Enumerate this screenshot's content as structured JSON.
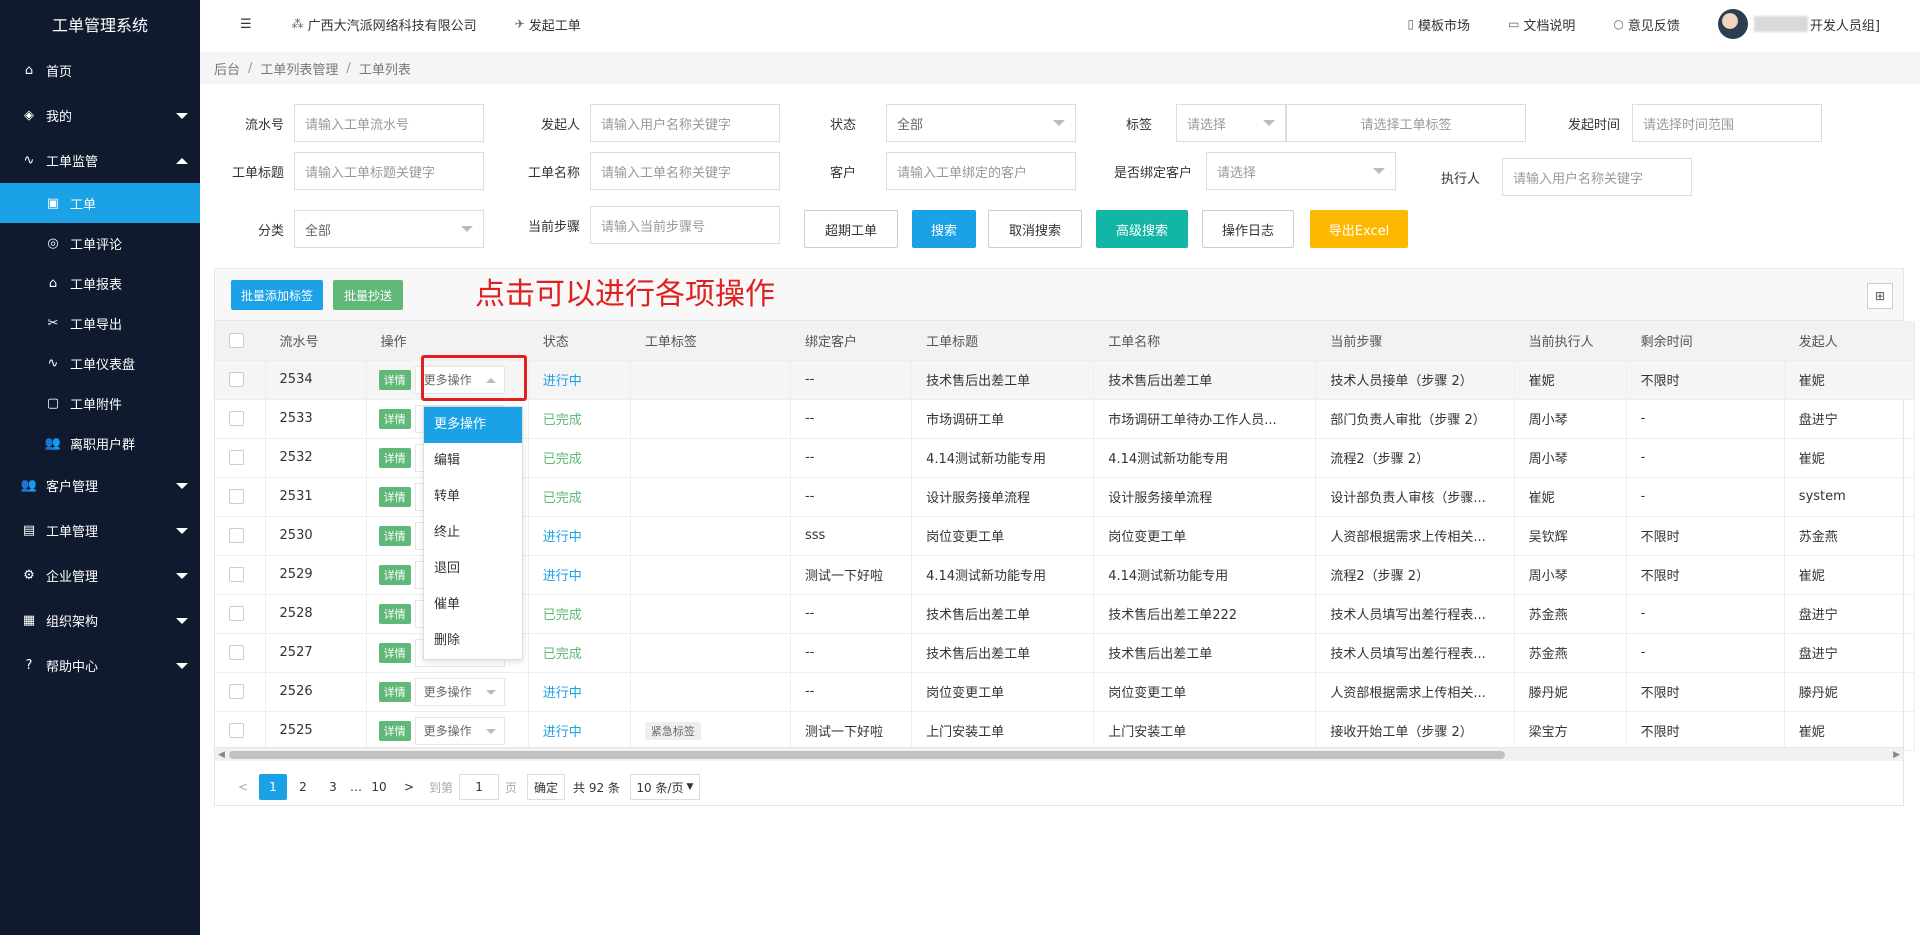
{
  "app": {
    "title": "工单管理系统"
  },
  "sidebar": {
    "items": [
      {
        "icon": "⌂",
        "label": "首页"
      },
      {
        "icon": "◈",
        "label": "我的"
      },
      {
        "icon": "∿",
        "label": "工单监管"
      },
      {
        "icon": "👥",
        "label": "客户管理"
      },
      {
        "icon": "▤",
        "label": "工单管理"
      },
      {
        "icon": "⚙",
        "label": "企业管理"
      },
      {
        "icon": "▦",
        "label": "组织架构"
      },
      {
        "icon": "?",
        "label": "帮助中心"
      }
    ],
    "submenu": [
      {
        "icon": "▣",
        "label": "工单"
      },
      {
        "icon": "◎",
        "label": "工单评论"
      },
      {
        "icon": "⌂",
        "label": "工单报表"
      },
      {
        "icon": "✂",
        "label": "工单导出"
      },
      {
        "icon": "∿",
        "label": "工单仪表盘"
      },
      {
        "icon": "▢",
        "label": "工单附件"
      },
      {
        "icon": "👥",
        "label": "离职用户群"
      }
    ]
  },
  "topbar": {
    "menu_icon": "☰",
    "company": "广西大汽派网络科技有限公司",
    "create": "发起工单",
    "template_market": "模板市场",
    "docs": "文档说明",
    "feedback": "意见反馈",
    "user_suffix": "开发人员组]"
  },
  "breadcrumb": {
    "items": [
      "后台",
      "工单列表管理",
      "工单列表"
    ],
    "sep": "/"
  },
  "filters": {
    "serial_label": "流水号",
    "serial_ph": "请输入工单流水号",
    "initiator_label": "发起人",
    "initiator_ph": "请输入用户名称关键字",
    "status_label": "状态",
    "status_value": "全部",
    "tag_label": "标签",
    "tag_select": "请选择",
    "tag_ph": "请选择工单标签",
    "time_label": "发起时间",
    "time_ph": "请选择时间范围",
    "title_label": "工单标题",
    "title_ph": "请输入工单标题关键字",
    "name_label": "工单名称",
    "name_ph": "请输入工单名称关键字",
    "customer_label": "客户",
    "customer_ph": "请输入工单绑定的客户",
    "bound_label": "是否绑定客户",
    "bound_value": "请选择",
    "executor_label": "执行人",
    "executor_ph": "请输入用户名称关键字",
    "category_label": "分类",
    "category_value": "全部",
    "step_label": "当前步骤",
    "step_ph": "请输入当前步骤号"
  },
  "buttons": {
    "overdue": "超期工单",
    "search": "搜索",
    "cancel_search": "取消搜索",
    "advanced": "高级搜索",
    "log": "操作日志",
    "export": "导出Excel"
  },
  "toolbar": {
    "batch_tag": "批量添加标签",
    "batch_copy": "批量抄送",
    "annotation": "点击可以进行各项操作",
    "grid_icon": "⊞"
  },
  "table": {
    "headers": [
      "流水号",
      "操作",
      "状态",
      "工单标签",
      "绑定客户",
      "工单标题",
      "工单名称",
      "当前步骤",
      "当前执行人",
      "剩余时间",
      "发起人"
    ],
    "detail_label": "详情",
    "more_label": "更多操作",
    "rows": [
      {
        "id": "2534",
        "status": "进行中",
        "status_type": "run",
        "tag": "",
        "customer": "--",
        "title": "技术售后出差工单",
        "name": "技术售后出差工单",
        "step": "技术人员接单（步骤 2）",
        "executor": "崔妮",
        "remaining": "不限时",
        "initiator": "崔妮"
      },
      {
        "id": "2533",
        "status": "已完成",
        "status_type": "done",
        "tag": "",
        "customer": "--",
        "title": "市场调研工单",
        "name": "市场调研工单待办工作人员...",
        "step": "部门负责人审批（步骤 2）",
        "executor": "周小琴",
        "remaining": "-",
        "initiator": "盘进宁"
      },
      {
        "id": "2532",
        "status": "已完成",
        "status_type": "done",
        "tag": "",
        "customer": "--",
        "title": "4.14测试新功能专用",
        "name": "4.14测试新功能专用",
        "step": "流程2（步骤 2）",
        "executor": "周小琴",
        "remaining": "-",
        "initiator": "崔妮"
      },
      {
        "id": "2531",
        "status": "已完成",
        "status_type": "done",
        "tag": "",
        "customer": "--",
        "title": "设计服务接单流程",
        "name": "设计服务接单流程",
        "step": "设计部负责人审核（步骤...",
        "executor": "崔妮",
        "remaining": "-",
        "initiator": "system"
      },
      {
        "id": "2530",
        "status": "进行中",
        "status_type": "run",
        "tag": "",
        "customer": "sss",
        "title": "岗位变更工单",
        "name": "岗位变更工单",
        "step": "人资部根据需求上传相关...",
        "executor": "吴钦辉",
        "remaining": "不限时",
        "initiator": "苏金燕"
      },
      {
        "id": "2529",
        "status": "进行中",
        "status_type": "run",
        "tag": "",
        "customer": "测试一下好啦",
        "title": "4.14测试新功能专用",
        "name": "4.14测试新功能专用",
        "step": "流程2（步骤 2）",
        "executor": "周小琴",
        "remaining": "不限时",
        "initiator": "崔妮"
      },
      {
        "id": "2528",
        "status": "已完成",
        "status_type": "done",
        "tag": "",
        "customer": "--",
        "title": "技术售后出差工单",
        "name": "技术售后出差工单222",
        "step": "技术人员填写出差行程表...",
        "executor": "苏金燕",
        "remaining": "-",
        "initiator": "盘进宁"
      },
      {
        "id": "2527",
        "status": "已完成",
        "status_type": "done",
        "tag": "",
        "customer": "--",
        "title": "技术售后出差工单",
        "name": "技术售后出差工单",
        "step": "技术人员填写出差行程表...",
        "executor": "苏金燕",
        "remaining": "-",
        "initiator": "盘进宁"
      },
      {
        "id": "2526",
        "status": "进行中",
        "status_type": "run",
        "tag": "",
        "customer": "--",
        "title": "岗位变更工单",
        "name": "岗位变更工单",
        "step": "人资部根据需求上传相关...",
        "executor": "滕丹妮",
        "remaining": "不限时",
        "initiator": "滕丹妮"
      },
      {
        "id": "2525",
        "status": "进行中",
        "status_type": "run",
        "tag": "紧急标签",
        "customer": "测试一下好啦",
        "title": "上门安装工单",
        "name": "上门安装工单",
        "step": "接收开始工单（步骤 2）",
        "executor": "梁宝方",
        "remaining": "不限时",
        "initiator": "崔妮"
      }
    ]
  },
  "dropdown": {
    "items": [
      "更多操作",
      "编辑",
      "转单",
      "终止",
      "退回",
      "催单",
      "删除"
    ]
  },
  "pagination": {
    "prev": "<",
    "pages": [
      "1",
      "2",
      "3"
    ],
    "ellipsis": "…",
    "last": "10",
    "next": ">",
    "goto_label": "到第",
    "goto_value": "1",
    "page_unit": "页",
    "confirm": "确定",
    "total": "共 92 条",
    "page_size": "10 条/页"
  }
}
